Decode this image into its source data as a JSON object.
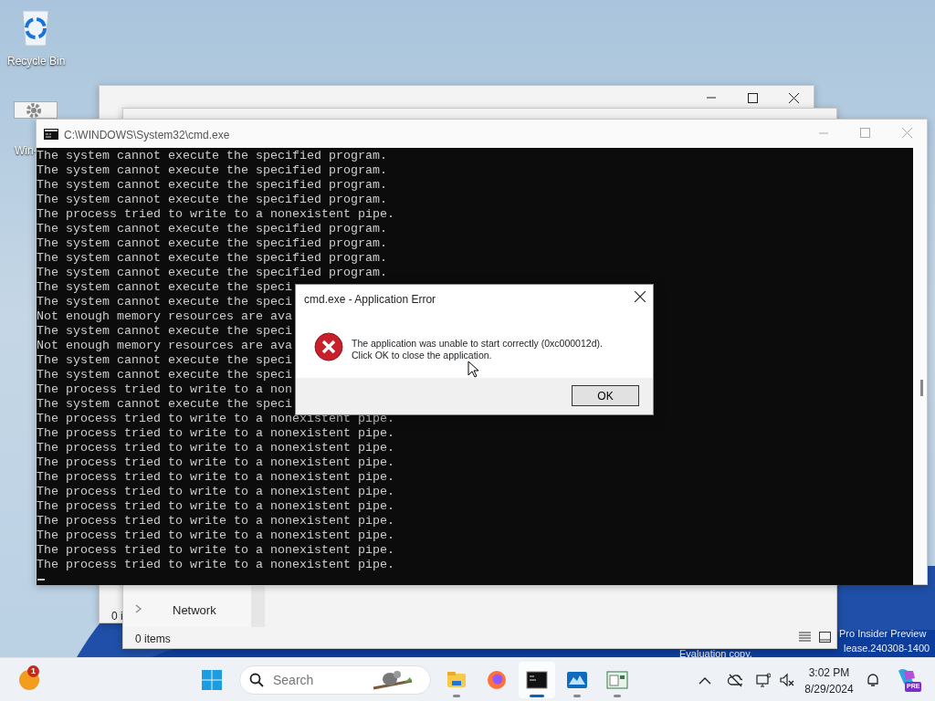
{
  "desktop": {
    "icons": [
      {
        "label": "Recycle Bin",
        "kind": "recycle"
      },
      {
        "label": "Win-",
        "kind": "settings"
      }
    ],
    "watermark": [
      "Pro Insider Preview",
      "Evaluation copy.",
      "lease.240308-1400"
    ]
  },
  "explorer_back": {
    "status": "0 i"
  },
  "explorer_front": {
    "nav_item": "Network",
    "status": "0 items"
  },
  "cmd_window": {
    "title": "C:\\WINDOWS\\System32\\cmd.exe",
    "lines": [
      "The system cannot execute the specified program.",
      "The system cannot execute the specified program.",
      "The system cannot execute the specified program.",
      "The system cannot execute the specified program.",
      "The process tried to write to a nonexistent pipe.",
      "The system cannot execute the specified program.",
      "The system cannot execute the specified program.",
      "The system cannot execute the specified program.",
      "The system cannot execute the specified program.",
      "The system cannot execute the speci",
      "The system cannot execute the speci",
      "Not enough memory resources are ava",
      "The system cannot execute the speci",
      "Not enough memory resources are ava",
      "The system cannot execute the speci",
      "The system cannot execute the speci",
      "The process tried to write to a non",
      "The system cannot execute the speci",
      "The process tried to write to a nonexistent pipe.",
      "The process tried to write to a nonexistent pipe.",
      "The process tried to write to a nonexistent pipe.",
      "The process tried to write to a nonexistent pipe.",
      "The process tried to write to a nonexistent pipe.",
      "The process tried to write to a nonexistent pipe.",
      "The process tried to write to a nonexistent pipe.",
      "The process tried to write to a nonexistent pipe.",
      "The process tried to write to a nonexistent pipe.",
      "The process tried to write to a nonexistent pipe.",
      "The process tried to write to a nonexistent pipe."
    ]
  },
  "dialog": {
    "title": "cmd.exe - Application Error",
    "message": [
      "The application was unable to start correctly (0xc000012d).",
      "Click OK to close the application."
    ],
    "button": "OK"
  },
  "taskbar": {
    "widget_badge": "1",
    "search": {
      "placeholder": "Search"
    },
    "apps": [
      {
        "kind": "explorer",
        "running": true,
        "active": false
      },
      {
        "kind": "firefox",
        "running": false,
        "active": false
      },
      {
        "kind": "terminal",
        "running": true,
        "active": true
      },
      {
        "kind": "monitor",
        "running": true,
        "active": false
      },
      {
        "kind": "panel",
        "running": true,
        "active": false
      }
    ],
    "clock": {
      "time": "3:02 PM",
      "date": "8/29/2024"
    },
    "copilot_badge": "PRE"
  }
}
